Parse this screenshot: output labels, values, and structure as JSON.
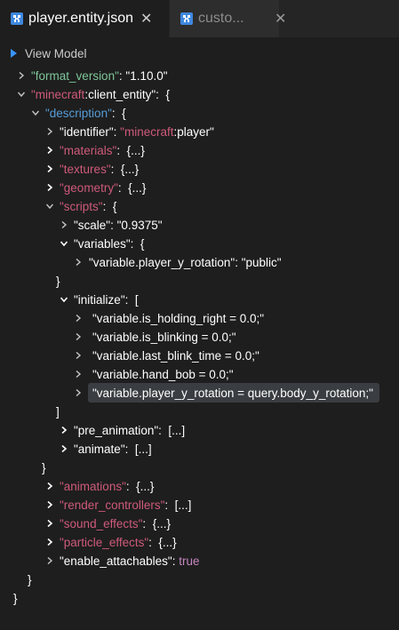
{
  "tabs": [
    {
      "label": "player.entity.json",
      "close": "✕",
      "active": true
    },
    {
      "label": "custo...",
      "close": "✕",
      "active": false
    }
  ],
  "view_model": {
    "label": "View Model"
  },
  "tree": {
    "format_version_key": "\"format_version\"",
    "format_version_val": "\"1.10.0\"",
    "client_entity_key_a": "\"minecraft",
    "client_entity_key_b": ":client_entity\"",
    "description_key": "\"description\"",
    "identifier_key": "\"identifier\"",
    "identifier_val_a": "\"minecraft",
    "identifier_val_b": ":player\"",
    "materials_key": "\"materials\"",
    "textures_key": "\"textures\"",
    "geometry_key": "\"geometry\"",
    "scripts_key": "\"scripts\"",
    "scale_key": "\"scale\"",
    "scale_val": "\"0.9375\"",
    "variables_key": "\"variables\"",
    "var_rot_key": "\"variable.player_y_rotation\"",
    "var_rot_val": "\"public\"",
    "initialize_key": "\"initialize\"",
    "init_items": [
      "\"variable.is_holding_right = 0.0;\"",
      "\"variable.is_blinking = 0.0;\"",
      "\"variable.last_blink_time = 0.0;\"",
      "\"variable.hand_bob = 0.0;\"",
      "\"variable.player_y_rotation = query.body_y_rotation;\""
    ],
    "pre_animation_key": "\"pre_animation\"",
    "animate_key": "\"animate\"",
    "animations_key": "\"animations\"",
    "render_controllers_key": "\"render_controllers\"",
    "sound_effects_key": "\"sound_effects\"",
    "particle_effects_key": "\"particle_effects\"",
    "enable_attachables_key": "\"enable_attachables\"",
    "enable_attachables_val": "true",
    "obj_collapsed": "{...}",
    "arr_collapsed": "[...]",
    "open_brace": "{",
    "close_brace": "}",
    "open_bracket": "[",
    "close_bracket": "]",
    "colon": ":"
  },
  "colors": {
    "accent_blue": "#3794ff",
    "key_blue": "#569cd6",
    "key_green": "#7ec699",
    "key_red": "#ce5a7a",
    "string_green": "#b5cea8",
    "bool_purple": "#c586c0"
  }
}
